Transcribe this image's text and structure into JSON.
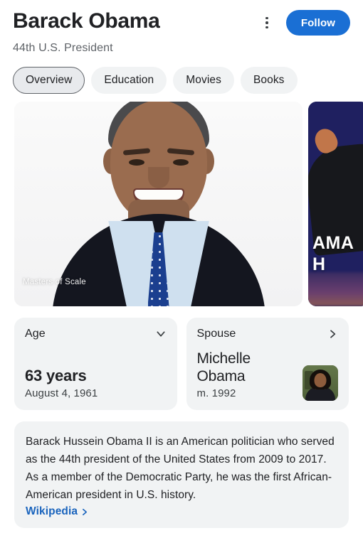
{
  "header": {
    "title": "Barack Obama",
    "subtitle": "44th U.S. President",
    "follow_label": "Follow",
    "kebab_icon": "more-vert-icon",
    "accent_color": "#1a6fd4"
  },
  "tabs": [
    {
      "label": "Overview",
      "active": true
    },
    {
      "label": "Education",
      "active": false
    },
    {
      "label": "Movies",
      "active": false
    },
    {
      "label": "Books",
      "active": false
    }
  ],
  "media": {
    "main": {
      "alt": "Barack Obama official portrait",
      "watermark": "Masters of Scale"
    },
    "second": {
      "alt": "Obama speaking on stage",
      "text_line1": "AMA",
      "text_line2": "H",
      "background_color": "#1f2060"
    }
  },
  "facts": [
    {
      "label": "Age",
      "icon": "chevron-down-icon",
      "value": "63 years",
      "sub": "August 4, 1961",
      "has_thumb": false
    },
    {
      "label": "Spouse",
      "icon": "chevron-right-icon",
      "value": "Michelle Obama",
      "sub": "m. 1992",
      "has_thumb": true,
      "thumb_alt": "Michelle Obama"
    }
  ],
  "description": {
    "text": "Barack Hussein Obama II is an American politician who served as the 44th president of the United States from 2009 to 2017. As a member of the Democratic Party, he was the first African-American president in U.S. history.",
    "source_label": "Wikipedia",
    "source_color": "#1a64bd"
  }
}
